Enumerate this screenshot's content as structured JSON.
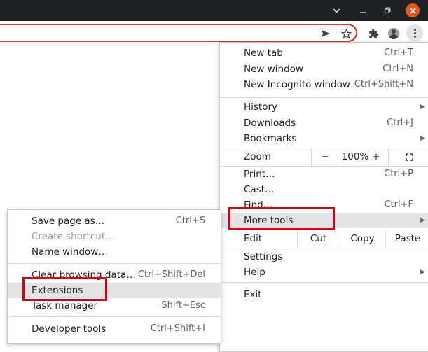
{
  "window_controls": {
    "dropdown_icon": "chevron-down-icon",
    "minimize_icon": "minimize-icon",
    "restore_icon": "restore-icon",
    "close_icon": "close-icon"
  },
  "toolbar": {
    "send_icon": "send-icon",
    "bookmark_icon": "star-icon",
    "extensions_icon": "puzzle-icon",
    "profile_icon": "avatar-icon",
    "menu_icon": "kebab-icon"
  },
  "main_menu": {
    "new_tab": {
      "label": "New tab",
      "shortcut": "Ctrl+T"
    },
    "new_window": {
      "label": "New window",
      "shortcut": "Ctrl+N"
    },
    "new_incognito": {
      "label": "New Incognito window",
      "shortcut": "Ctrl+Shift+N"
    },
    "history": {
      "label": "History"
    },
    "downloads": {
      "label": "Downloads",
      "shortcut": "Ctrl+J"
    },
    "bookmarks": {
      "label": "Bookmarks"
    },
    "zoom": {
      "label": "Zoom",
      "minus": "−",
      "value": "100%",
      "plus": "+"
    },
    "print": {
      "label": "Print…",
      "shortcut": "Ctrl+P"
    },
    "cast": {
      "label": "Cast…"
    },
    "find": {
      "label": "Find…",
      "shortcut": "Ctrl+F"
    },
    "more_tools": {
      "label": "More tools"
    },
    "edit": {
      "label": "Edit",
      "cut": "Cut",
      "copy": "Copy",
      "paste": "Paste"
    },
    "settings": {
      "label": "Settings"
    },
    "help": {
      "label": "Help"
    },
    "exit": {
      "label": "Exit"
    }
  },
  "sub_menu": {
    "save_page": {
      "label": "Save page as…",
      "shortcut": "Ctrl+S"
    },
    "create_shortcut": {
      "label": "Create shortcut…"
    },
    "name_window": {
      "label": "Name window…"
    },
    "clear_browsing": {
      "label": "Clear browsing data…",
      "shortcut": "Ctrl+Shift+Del"
    },
    "extensions": {
      "label": "Extensions"
    },
    "task_manager": {
      "label": "Task manager",
      "shortcut": "Shift+Esc"
    },
    "developer_tools": {
      "label": "Developer tools",
      "shortcut": "Ctrl+Shift+I"
    }
  },
  "colors": {
    "highlight_box": "#d0021b",
    "omnibox_border": "#d93025",
    "titlebar": "#202124",
    "close_button": "#e95420",
    "hover_row": "#e3e3e3"
  }
}
